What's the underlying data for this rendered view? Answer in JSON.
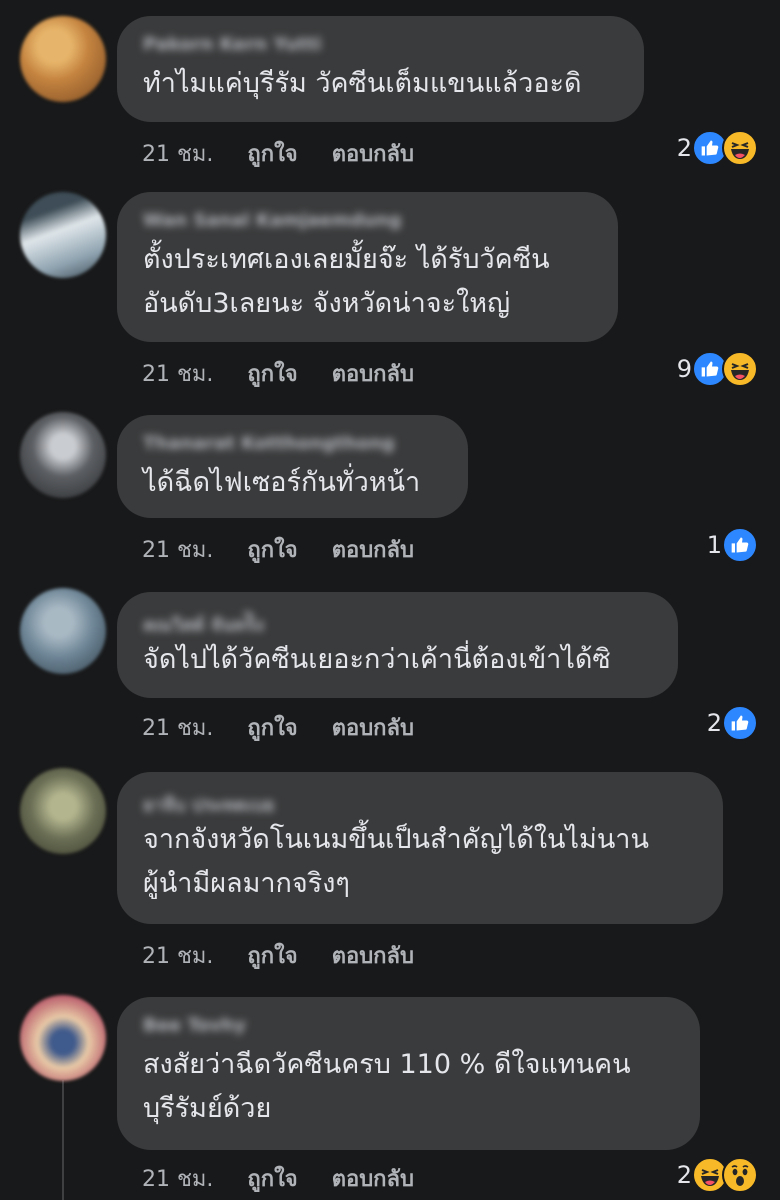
{
  "comments": [
    {
      "author": "Pakorn Kern Yutti",
      "text": "ทำไมแค่บุรีรัม วัคซีนเต็มแขนแล้วอะดิ",
      "time": "21 ชม.",
      "like_label": "ถูกใจ",
      "reply_label": "ตอบกลับ",
      "reaction_count": "2",
      "reactions": [
        "like-icon",
        "haha-icon"
      ],
      "avatar_colors": [
        "#c4833f",
        "#e6b46a",
        "#7a4a22"
      ]
    },
    {
      "author": "Wan Sanal Kamjaemdung",
      "text": "ตั้งประเทศเองเลยมั้ยจ๊ะ ได้รับวัคซีน\nอันดับ3เลยนะ จังหวัดน่าจะใหญ่",
      "time": "21 ชม.",
      "like_label": "ถูกใจ",
      "reply_label": "ตอบกลับ",
      "reaction_count": "9",
      "reactions": [
        "like-icon",
        "haha-icon"
      ],
      "avatar_colors": [
        "#8fa3b0",
        "#dfe6ea",
        "#3e4d57"
      ]
    },
    {
      "author": "Thanarat Kotthongthong",
      "text": "ได้ฉีดไฟเซอร์กันทั่วหน้า",
      "time": "21 ชม.",
      "like_label": "ถูกใจ",
      "reply_label": "ตอบกลับ",
      "reaction_count": "1",
      "reactions": [
        "like-icon"
      ],
      "avatar_colors": [
        "#5c5f63",
        "#c9ccd0",
        "#2a2c2f"
      ]
    },
    {
      "author": "คุณวิสต์ จันทร์ิง",
      "text": "จัดไปได้วัคซีนเยอะกว่าเค้านี่ต้องเข้าได้ซิ",
      "time": "21 ชม.",
      "like_label": "ถูกใจ",
      "reply_label": "ตอบกลับ",
      "reaction_count": "2",
      "reactions": [
        "like-icon"
      ],
      "avatar_colors": [
        "#6d8596",
        "#a9b9c4",
        "#33414b"
      ]
    },
    {
      "author": "ยาจีบ ประทดเบยุ",
      "text": "จากจังหวัดโนเนมขึ้นเป็นสำคัญได้ในไม่นาน\nผู้นำมีผลมากจริงๆ",
      "time": "21 ชม.",
      "like_label": "ถูกใจ",
      "reply_label": "ตอบกลับ",
      "reaction_count": "",
      "reactions": [],
      "avatar_colors": [
        "#6b6f55",
        "#b3b58e",
        "#3a3c2c"
      ]
    },
    {
      "author": "Bee Tovhy",
      "text": "สงสัยว่าฉีดวัคซีนครบ 110 % ดีใจแทนคน\nบุรีรัมย์ด้วย",
      "time": "21 ชม.",
      "like_label": "ถูกใจ",
      "reply_label": "ตอบกลับ",
      "reaction_count": "2",
      "reactions": [
        "haha-icon",
        "wow-icon"
      ],
      "avatar_colors": [
        "#b85a6a",
        "#e8c9a6",
        "#3f5a8c"
      ]
    }
  ]
}
